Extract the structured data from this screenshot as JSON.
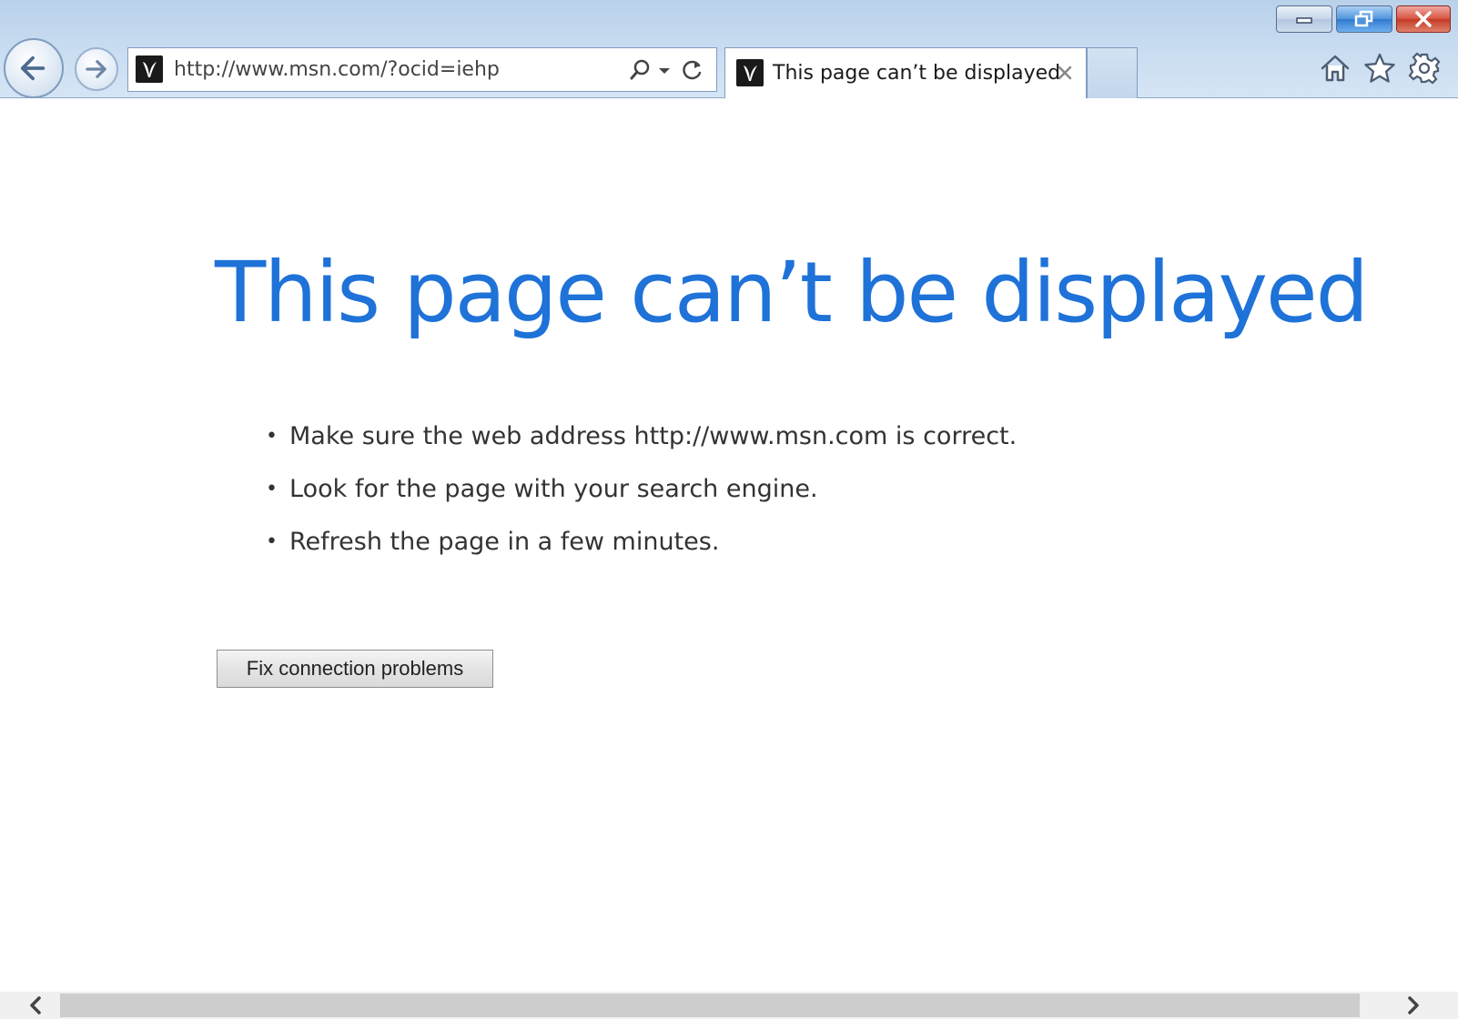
{
  "browser": {
    "address_bar": {
      "url": "http://www.msn.com/?ocid=iehp",
      "favicon": "msn-butterfly-icon",
      "search_icon": "search-icon",
      "dropdown_icon": "chevron-down-icon",
      "refresh_icon": "refresh-icon"
    },
    "navigation": {
      "back_icon": "back-arrow-icon",
      "forward_icon": "forward-arrow-icon"
    },
    "tabs": [
      {
        "title": "This page can’t be displayed",
        "favicon": "msn-butterfly-icon",
        "close_icon": "close-icon",
        "active": true
      }
    ],
    "toolbar_icons": [
      "home-icon",
      "star-icon",
      "gear-icon"
    ],
    "window_controls": [
      "minimize-icon",
      "restore-icon",
      "close-icon"
    ]
  },
  "error_page": {
    "title": "This page can’t be displayed",
    "suggestions": [
      "Make sure the web address http://www.msn.com is correct.",
      "Look for the page with your search engine.",
      "Refresh the page in a few minutes."
    ],
    "fix_button_label": "Fix connection problems"
  },
  "colors": {
    "title_blue": "#1e72d8",
    "toolbar_bg": "#c7dbf0",
    "close_red": "#c33a24"
  }
}
